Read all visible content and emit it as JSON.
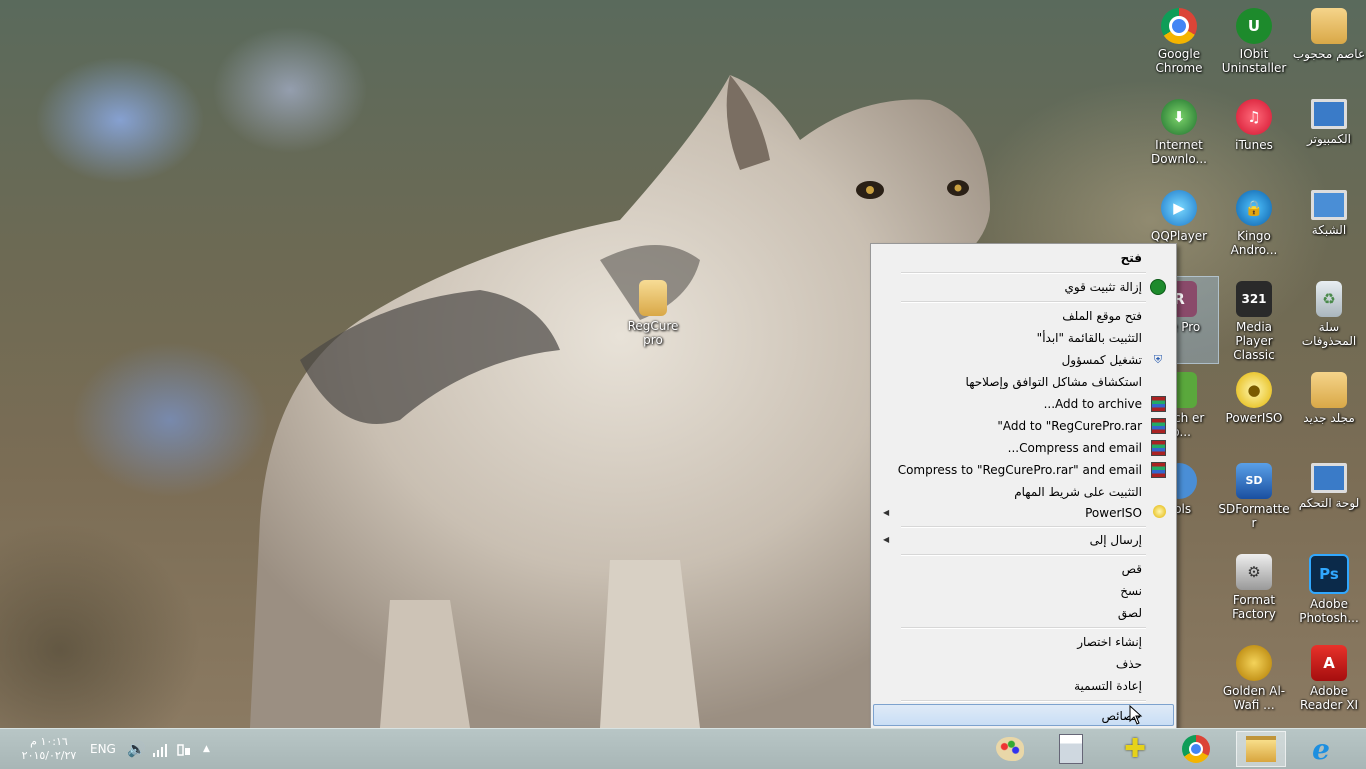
{
  "desktop": {
    "icons": [
      {
        "label": "Google Chrome",
        "icon": "chrome-icon"
      },
      {
        "label": "IObit Uninstaller",
        "icon": "iobit-uninstaller-icon"
      },
      {
        "label": "عاصم محجوب",
        "icon": "user-folder-icon"
      },
      {
        "label": "Internet Downlo...",
        "icon": "internet-download-manager-icon"
      },
      {
        "label": "iTunes",
        "icon": "itunes-icon"
      },
      {
        "label": "الكمبيوتر",
        "icon": "computer-icon"
      },
      {
        "label": "QQPlayer",
        "icon": "qqplayer-icon"
      },
      {
        "label": "Kingo Andro...",
        "icon": "kingo-android-root-icon"
      },
      {
        "label": "الشبكة",
        "icon": "network-icon"
      },
      {
        "label": "ure Pro",
        "icon": "regcure-pro-icon"
      },
      {
        "label": "Media Player Classic",
        "icon": "media-player-classic-icon"
      },
      {
        "label": "سلة المحذوفات",
        "icon": "recycle-bin-icon"
      },
      {
        "label": "Batch er To...",
        "icon": "batch-converter-icon"
      },
      {
        "label": "PowerISO",
        "icon": "poweriso-icon"
      },
      {
        "label": "مجلد جديد",
        "icon": "folder-icon"
      },
      {
        "label": "ools",
        "icon": "tools-icon"
      },
      {
        "label": "SDFormatter",
        "icon": "sdformatter-icon"
      },
      {
        "label": "لوحة التحكم",
        "icon": "control-panel-icon"
      },
      {
        "label": "Format Factory",
        "icon": "format-factory-icon"
      },
      {
        "label": "Adobe Photosh...",
        "icon": "photoshop-icon"
      },
      {
        "label": "Golden Al-Wafi ...",
        "icon": "golden-alwafi-icon"
      },
      {
        "label": "Adobe Reader XI",
        "icon": "adobe-reader-icon"
      },
      {
        "label": "RegCure pro",
        "icon": "folder-icon"
      }
    ]
  },
  "context_menu": {
    "items": [
      {
        "label": "فتح",
        "icon": ""
      },
      {
        "label": "إزالة تثبيت قوي",
        "icon": "iobit-icon"
      },
      {
        "label": "فتح موقع الملف",
        "icon": ""
      },
      {
        "label": "التثبيت بالقائمة \"ابدأ\"",
        "icon": ""
      },
      {
        "label": "تشغيل كمسؤول",
        "icon": "uac-shield-icon"
      },
      {
        "label": "استكشاف مشاكل التوافق وإصلاحها",
        "icon": ""
      },
      {
        "label": "Add to archive...",
        "icon": "winrar-icon"
      },
      {
        "label": "Add to \"RegCurePro.rar\"",
        "icon": "winrar-icon"
      },
      {
        "label": "Compress and email...",
        "icon": "winrar-icon"
      },
      {
        "label": "Compress to \"RegCurePro.rar\" and email",
        "icon": "winrar-icon"
      },
      {
        "label": "التثبيت على شريط المهام",
        "icon": ""
      },
      {
        "label": "PowerISO",
        "icon": "poweriso-icon"
      },
      {
        "label": "إرسال إلى",
        "icon": ""
      },
      {
        "label": "قص",
        "icon": ""
      },
      {
        "label": "نسخ",
        "icon": ""
      },
      {
        "label": "لصق",
        "icon": ""
      },
      {
        "label": "إنشاء اختصار",
        "icon": ""
      },
      {
        "label": "حذف",
        "icon": ""
      },
      {
        "label": "إعادة التسمية",
        "icon": ""
      },
      {
        "label": "خصائص",
        "icon": ""
      }
    ]
  },
  "taskbar": {
    "apps": [
      "paint-icon",
      "calculator-icon",
      "add-remove-icon",
      "chrome-icon",
      "file-explorer-icon",
      "internet-explorer-icon"
    ],
    "tray": {
      "language": "ENG",
      "time": "١٠:١٦ م",
      "date": "٢٠١٥/٠٢/٢٧"
    }
  }
}
